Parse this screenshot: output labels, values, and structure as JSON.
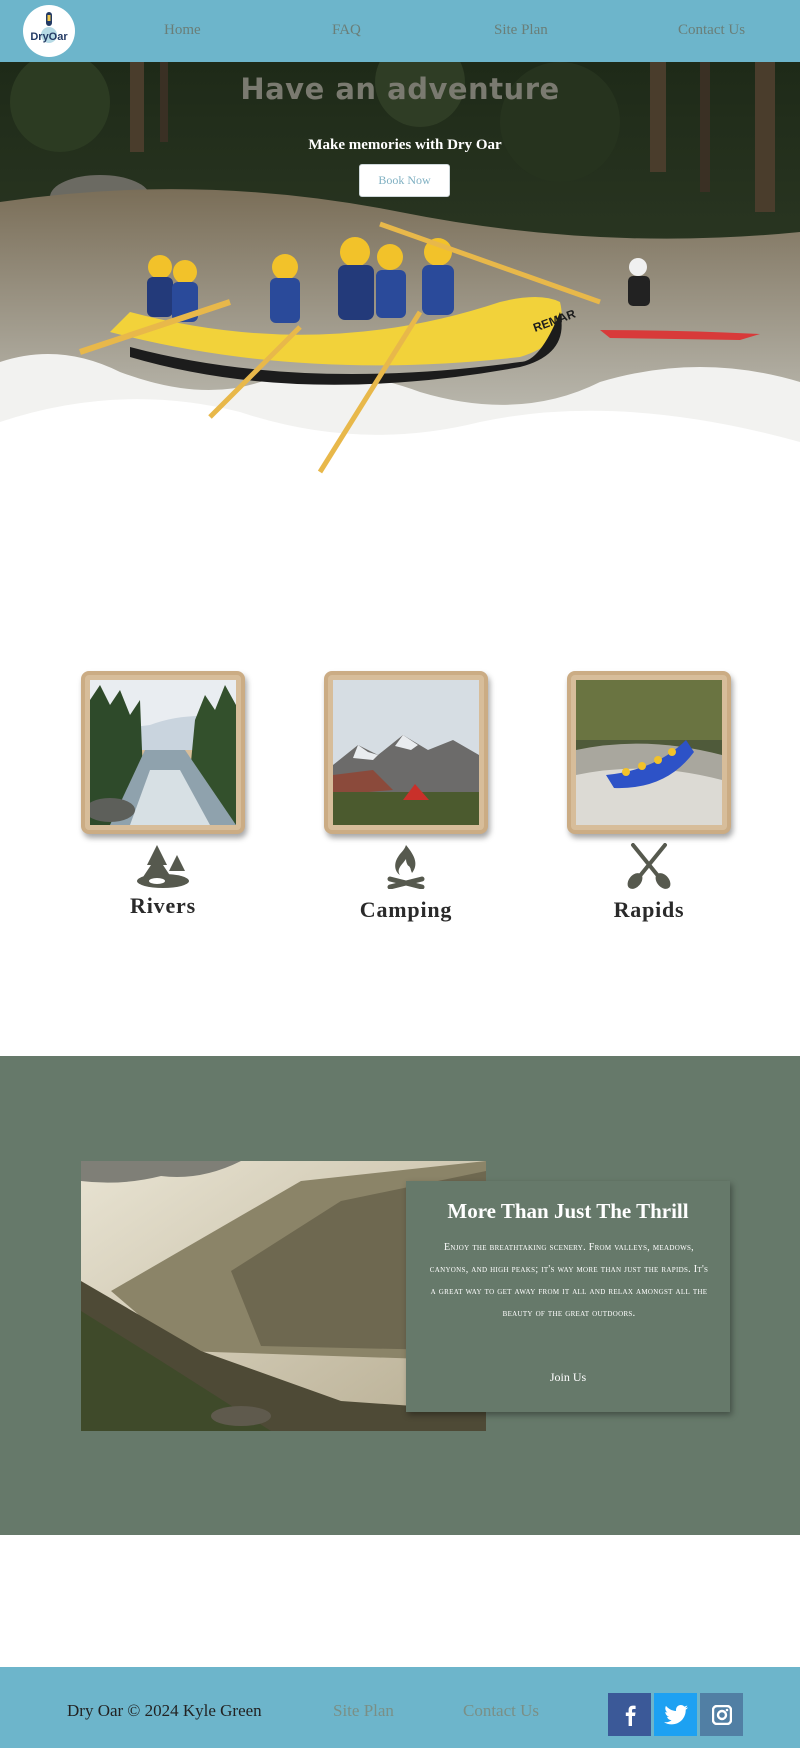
{
  "nav": {
    "logo_text": "DryOar",
    "links": [
      "Home",
      "FAQ",
      "Site Plan",
      "Contact Us"
    ]
  },
  "hero": {
    "title": "Have an adventure",
    "subtitle": "Make memories with Dry Oar",
    "button_label": "Book Now",
    "raft_text": "REMAR"
  },
  "features": [
    {
      "label": "Rivers",
      "icon": "pine-trees-icon"
    },
    {
      "label": "Camping",
      "icon": "campfire-icon"
    },
    {
      "label": "Rapids",
      "icon": "crossed-oars-icon"
    }
  ],
  "promo": {
    "title": "More Than Just The Thrill",
    "text": "Enjoy the breathtaking scenery. From valleys, meadows, canyons, and high peaks; it's way more than just the rapids. It's a great way to get away from it all and relax amongst all the beauty of the great outdoors.",
    "link_label": "Join Us"
  },
  "footer": {
    "copyright": "Dry Oar © 2024 Kyle Green",
    "links": [
      "Site Plan",
      "Contact Us"
    ],
    "social": [
      {
        "name": "facebook",
        "color": "#3b5998"
      },
      {
        "name": "twitter",
        "color": "#1da1f2"
      },
      {
        "name": "instagram",
        "color": "#517fa4"
      }
    ]
  },
  "colors": {
    "nav": "#6db5cb",
    "green_section": "#66796a",
    "frame": "#d7bd9a",
    "icon": "#56594e"
  }
}
